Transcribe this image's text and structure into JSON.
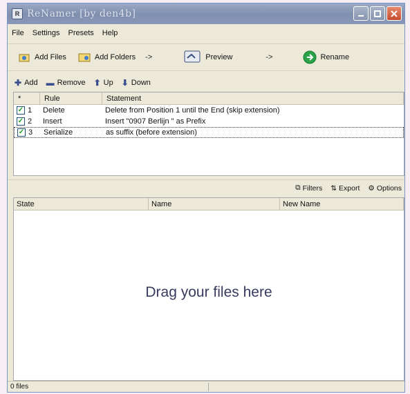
{
  "window": {
    "title": "ReNamer [by den4b]",
    "controls": [
      "minimize",
      "maximize",
      "close"
    ]
  },
  "menu": [
    "File",
    "Settings",
    "Presets",
    "Help"
  ],
  "toolbar": {
    "add_files": "Add Files",
    "add_folders": "Add Folders",
    "arrow1": "->",
    "preview": "Preview",
    "arrow2": "->",
    "rename": "Rename"
  },
  "rules_toolbar": {
    "add": "Add",
    "remove": "Remove",
    "up": "Up",
    "down": "Down"
  },
  "rules_table": {
    "headers": [
      "*",
      "Rule",
      "Statement"
    ],
    "rows": [
      {
        "index": "1",
        "checked": true,
        "rule": "Delete",
        "statement": "Delete from Position 1 until the End (skip extension)"
      },
      {
        "index": "2",
        "checked": true,
        "rule": "Insert",
        "statement": "Insert \"0907 Berlijn \" as Prefix"
      },
      {
        "index": "3",
        "checked": true,
        "rule": "Serialize",
        "statement": "as suffix (before extension)"
      }
    ]
  },
  "files_toolbar": {
    "filters": "Filters",
    "export": "Export",
    "options": "Options"
  },
  "files_table": {
    "headers": [
      "State",
      "Name",
      "New Name"
    ],
    "drag_hint": "Drag your files here"
  },
  "status": {
    "files": "0 files"
  }
}
